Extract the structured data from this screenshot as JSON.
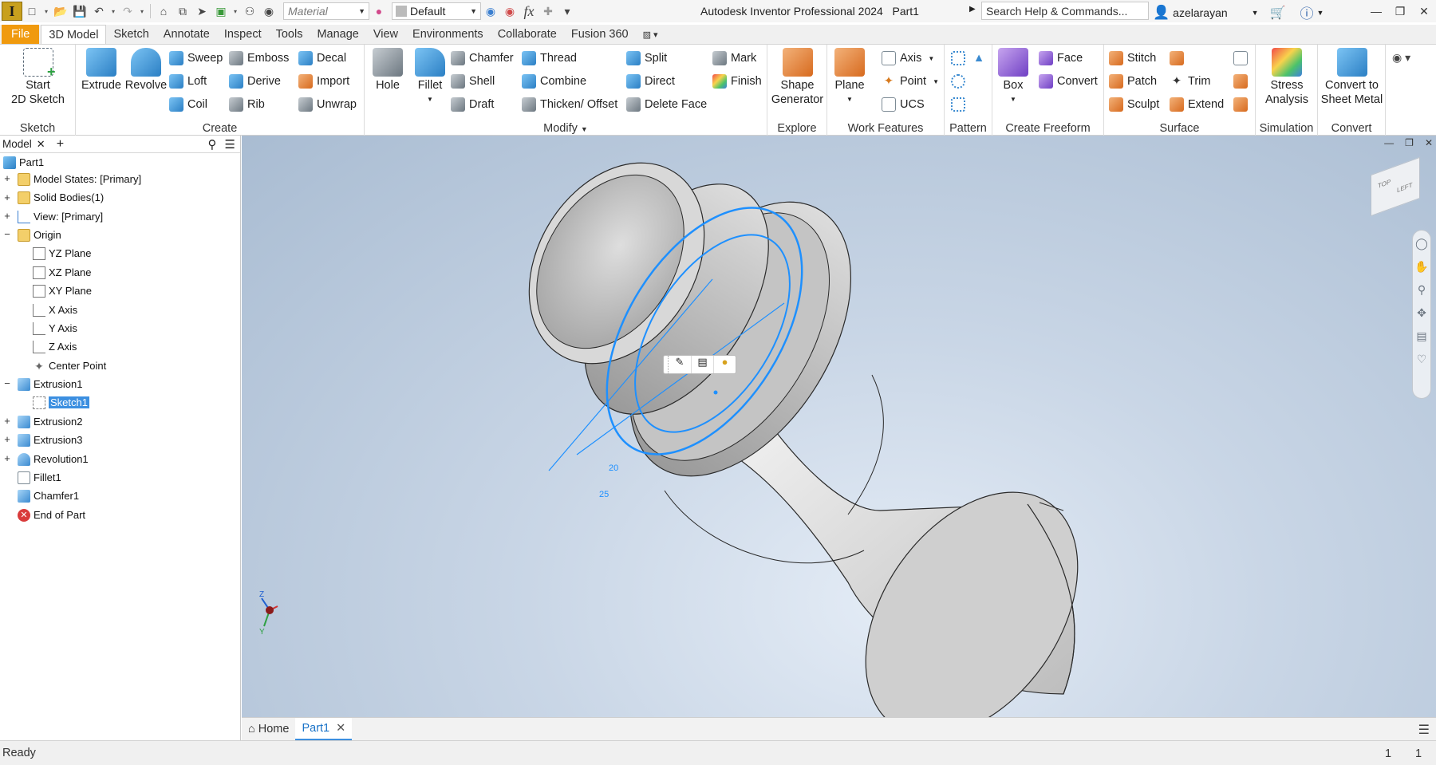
{
  "app": {
    "window_title": "Autodesk Inventor Professional 2024",
    "document_name": "Part1",
    "logo_letter": "I"
  },
  "quick_access": {
    "material_placeholder": "Material",
    "appearance_value": "Default",
    "fx_label": "fx"
  },
  "search": {
    "placeholder": "Search Help & Commands..."
  },
  "user": {
    "name": "azelarayan"
  },
  "ribbon_tabs": [
    {
      "label": "File"
    },
    {
      "label": "3D Model"
    },
    {
      "label": "Sketch"
    },
    {
      "label": "Annotate"
    },
    {
      "label": "Inspect"
    },
    {
      "label": "Tools"
    },
    {
      "label": "Manage"
    },
    {
      "label": "View"
    },
    {
      "label": "Environments"
    },
    {
      "label": "Collaborate"
    },
    {
      "label": "Fusion 360"
    }
  ],
  "ribbon": {
    "sketch": {
      "title": "Sketch",
      "start_sketch": "Start",
      "start_sketch_2": "2D Sketch"
    },
    "create": {
      "title": "Create",
      "extrude": "Extrude",
      "revolve": "Revolve",
      "sweep": "Sweep",
      "loft": "Loft",
      "coil": "Coil",
      "emboss": "Emboss",
      "derive": "Derive",
      "rib": "Rib",
      "decal": "Decal",
      "import": "Import",
      "unwrap": "Unwrap"
    },
    "modify": {
      "title": "Modify",
      "hole": "Hole",
      "fillet": "Fillet",
      "chamfer": "Chamfer",
      "shell": "Shell",
      "draft": "Draft",
      "thread": "Thread",
      "combine": "Combine",
      "thicken": "Thicken/ Offset",
      "split": "Split",
      "direct": "Direct",
      "delete_face": "Delete Face",
      "mark": "Mark",
      "finish": "Finish"
    },
    "explore": {
      "title": "Explore",
      "shape_generator": "Shape",
      "shape_generator_2": "Generator"
    },
    "work_features": {
      "title": "Work Features",
      "plane": "Plane",
      "axis": "Axis",
      "point": "Point",
      "ucs": "UCS"
    },
    "pattern": {
      "title": "Pattern"
    },
    "freeform": {
      "title": "Create Freeform",
      "box": "Box",
      "face": "Face",
      "convert": "Convert"
    },
    "surface": {
      "title": "Surface",
      "stitch": "Stitch",
      "patch": "Patch",
      "sculpt": "Sculpt",
      "trim": "Trim",
      "extend": "Extend"
    },
    "simulation": {
      "title": "Simulation",
      "stress": "Stress",
      "stress_2": "Analysis"
    },
    "convert": {
      "title": "Convert",
      "sheet_metal": "Convert to",
      "sheet_metal_2": "Sheet Metal"
    }
  },
  "browser": {
    "tab_label": "Model",
    "tree": [
      {
        "label": "Part1"
      },
      {
        "label": "Model States: [Primary]"
      },
      {
        "label": "Solid Bodies(1)"
      },
      {
        "label": "View: [Primary]"
      },
      {
        "label": "Origin"
      },
      {
        "label": "YZ Plane"
      },
      {
        "label": "XZ Plane"
      },
      {
        "label": "XY Plane"
      },
      {
        "label": "X Axis"
      },
      {
        "label": "Y Axis"
      },
      {
        "label": "Z Axis"
      },
      {
        "label": "Center Point"
      },
      {
        "label": "Extrusion1"
      },
      {
        "label": "Sketch1"
      },
      {
        "label": "Extrusion2"
      },
      {
        "label": "Extrusion3"
      },
      {
        "label": "Revolution1"
      },
      {
        "label": "Fillet1"
      },
      {
        "label": "Chamfer1"
      },
      {
        "label": "End of Part"
      }
    ]
  },
  "viewport": {
    "dimension_inner": "20",
    "dimension_outer": "25",
    "viewcube_face": "LEFT",
    "viewcube_top": "TOP",
    "triad_z": "Z",
    "triad_y": "Y"
  },
  "doc_tabs": [
    {
      "label": "Home"
    },
    {
      "label": "Part1"
    }
  ],
  "status": {
    "text": "Ready",
    "n1": "1",
    "n2": "1"
  },
  "colors": {
    "accent": "#3c8fe0",
    "file_tab": "#f09a0e",
    "sketch_blue": "#1e90ff"
  }
}
